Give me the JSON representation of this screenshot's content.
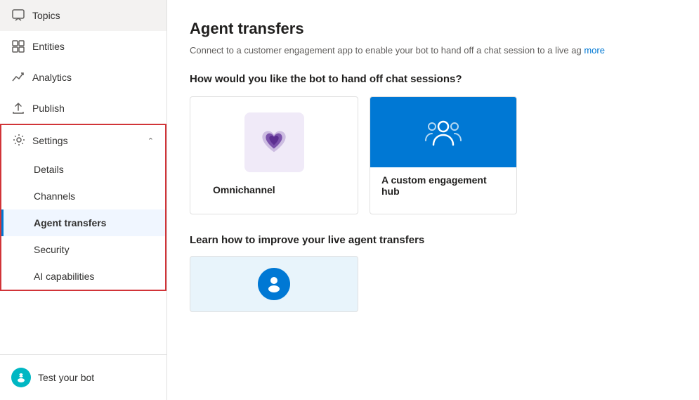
{
  "sidebar": {
    "items": [
      {
        "id": "topics",
        "label": "Topics",
        "icon": "💬"
      },
      {
        "id": "entities",
        "label": "Entities",
        "icon": "⊞"
      },
      {
        "id": "analytics",
        "label": "Analytics",
        "icon": "↗"
      },
      {
        "id": "publish",
        "label": "Publish",
        "icon": "↑"
      },
      {
        "id": "settings",
        "label": "Settings",
        "icon": "⚙",
        "expanded": true,
        "children": [
          {
            "id": "details",
            "label": "Details"
          },
          {
            "id": "channels",
            "label": "Channels"
          },
          {
            "id": "agent-transfers",
            "label": "Agent transfers",
            "active": true
          },
          {
            "id": "security",
            "label": "Security"
          },
          {
            "id": "ai-capabilities",
            "label": "AI capabilities"
          }
        ]
      }
    ],
    "bottom": {
      "label": "Test your bot",
      "icon": "robot"
    }
  },
  "main": {
    "title": "Agent transfers",
    "subtitle": "Connect to a customer engagement app to enable your bot to hand off a chat session to a live ag",
    "subtitle_link": "more",
    "handoff_question": "How would you like the bot to hand off chat sessions?",
    "cards": [
      {
        "id": "omnichannel",
        "label": "Omnichannel"
      },
      {
        "id": "custom-hub",
        "label": "A custom engagement hub"
      }
    ],
    "learn_title": "Learn how to improve your live agent transfers"
  }
}
